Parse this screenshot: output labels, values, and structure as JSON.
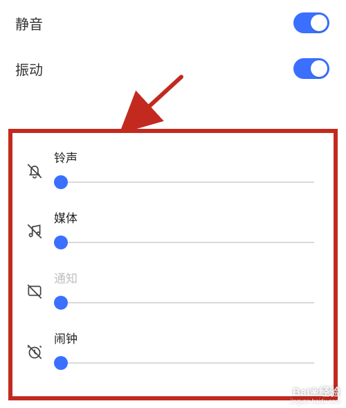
{
  "toggles": {
    "mute": {
      "label": "静音",
      "on": true
    },
    "vibrate": {
      "label": "振动",
      "on": true
    }
  },
  "sliders": {
    "ringtone": {
      "label": "铃声",
      "value_percent": 0,
      "icon": "bell-off-icon",
      "disabled": false
    },
    "media": {
      "label": "媒体",
      "value_percent": 0,
      "icon": "music-off-icon",
      "disabled": false
    },
    "notification": {
      "label": "通知",
      "value_percent": 0,
      "icon": "notification-off-icon",
      "disabled": true
    },
    "alarm": {
      "label": "闹钟",
      "value_percent": 0,
      "icon": "alarm-off-icon",
      "disabled": false
    }
  },
  "annotation": {
    "arrow_color": "#c22a1f",
    "box_color": "#c22a1f"
  },
  "watermark": {
    "line1": "Bai❀经验",
    "line2": "jingyan.baidu.com"
  }
}
